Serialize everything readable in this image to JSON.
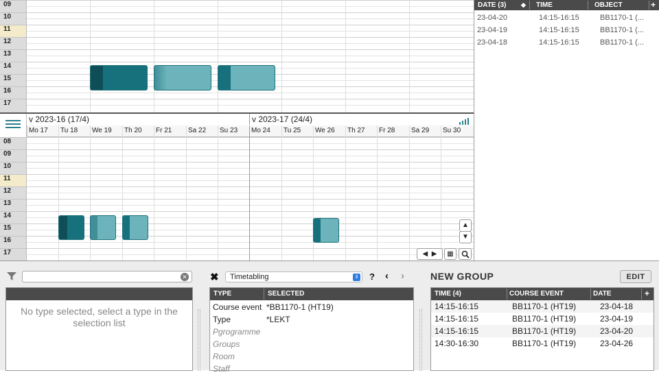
{
  "top_calendar": {
    "hours": [
      "09",
      "10",
      "11",
      "12",
      "13",
      "14",
      "15",
      "16",
      "17"
    ],
    "highlight_hour": "11"
  },
  "right_list": {
    "headers": {
      "date": "DATE (3)",
      "time": "TIME",
      "object": "OBJECT"
    },
    "rows": [
      {
        "date": "23-04-20",
        "time": "14:15-16:15",
        "object": "BB1170-1 (..."
      },
      {
        "date": "23-04-19",
        "time": "14:15-16:15",
        "object": "BB1170-1 (..."
      },
      {
        "date": "23-04-18",
        "time": "14:15-16:15",
        "object": "BB1170-1 (..."
      }
    ]
  },
  "bottom_calendar": {
    "weeks": [
      "v 2023-16 (17/4)",
      "v 2023-17 (24/4)"
    ],
    "days": [
      "Mo 17",
      "Tu 18",
      "We 19",
      "Th 20",
      "Fr 21",
      "Sa 22",
      "Su 23",
      "Mo 24",
      "Tu 25",
      "We 26",
      "Th 27",
      "Fr 28",
      "Sa 29",
      "Su 30"
    ],
    "hours": [
      "08",
      "09",
      "10",
      "11",
      "12",
      "13",
      "14",
      "15",
      "16",
      "17"
    ],
    "highlight_hour": "11"
  },
  "filter_panel": {
    "search_value": "",
    "empty_message": "No type selected, select a type in the selection list"
  },
  "selection_panel": {
    "dropdown_value": "Timetabling",
    "headers": {
      "type": "TYPE",
      "selected": "SELECTED"
    },
    "rows": [
      {
        "type": "Course event",
        "selected": "*BB1170-1 (HT19)",
        "active": true
      },
      {
        "type": "Type",
        "selected": "*LEKT",
        "active": true
      },
      {
        "type": "Pgrogramme",
        "selected": "",
        "active": false
      },
      {
        "type": "Groups",
        "selected": "",
        "active": false
      },
      {
        "type": "Room",
        "selected": "",
        "active": false
      },
      {
        "type": "Staff",
        "selected": "",
        "active": false
      }
    ]
  },
  "group_panel": {
    "title": "NEW GROUP",
    "edit_label": "EDIT",
    "headers": {
      "time": "TIME (4)",
      "course_event": "COURSE EVENT",
      "date": "DATE"
    },
    "rows": [
      {
        "time": "14:15-16:15",
        "course_event": "BB1170-1 (HT19)",
        "date": "23-04-18"
      },
      {
        "time": "14:15-16:15",
        "course_event": "BB1170-1 (HT19)",
        "date": "23-04-19"
      },
      {
        "time": "14:15-16:15",
        "course_event": "BB1170-1 (HT19)",
        "date": "23-04-20"
      },
      {
        "time": "14:30-16:30",
        "course_event": "BB1170-1 (HT19)",
        "date": "23-04-26"
      }
    ]
  },
  "colors": {
    "event_dark": "#17717d",
    "event_light": "#6cb3bb",
    "event_stripe": "#0f4e57",
    "header_dark": "#4a4a4a",
    "hour_highlight": "#f3ebc9"
  }
}
